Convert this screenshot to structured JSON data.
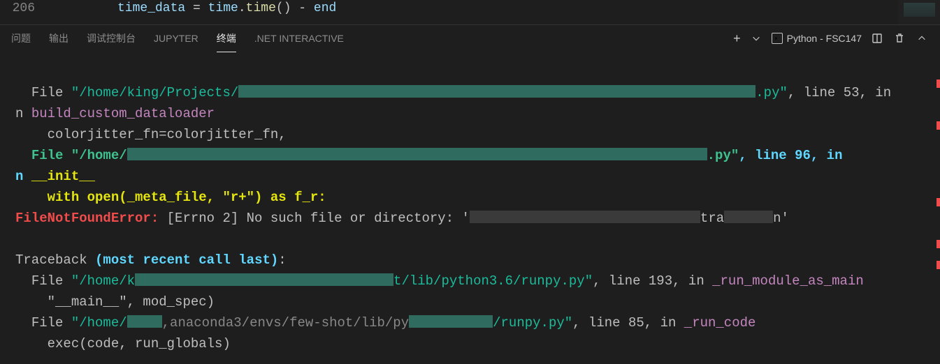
{
  "editor": {
    "line_number": "206",
    "code_frag_1": "time_data ",
    "code_frag_2": "=",
    "code_frag_3": " time",
    "code_frag_4": ".",
    "code_frag_5": "time",
    "code_frag_6": "() ",
    "code_frag_7": "-",
    "code_frag_8": " end"
  },
  "panel_tabs": {
    "problems": "问题",
    "output": "输出",
    "debug_console": "调试控制台",
    "jupyter": "JUPYTER",
    "terminal": "终端",
    "dotnet": ".NET INTERACTIVE"
  },
  "panel_actions": {
    "new_terminal_plus": "+",
    "launch_profile_label": "Python - FSC147"
  },
  "terminal": {
    "l1_file": "  File ",
    "l1_path_a": "\"/home/king/Projects/",
    "l1_path_b": ".py\"",
    "l1_tail": ", line 53, in ",
    "l1_func": "build_custom_dataloader",
    "l2": "    colorjitter_fn=colorjitter_fn,",
    "l3_file": "  File ",
    "l3_path_a": "\"/home/",
    "l3_path_b": ".py\"",
    "l3_tail": ", line 96, in ",
    "l3_func": "__init__",
    "l4": "    with open(_meta_file, \"r+\") as f_r:",
    "l5_err": "FileNotFoundError:",
    "l5_msg": " [Errno 2] No such file or directory: '",
    "l5_msg_b": "tra",
    "l5_msg_c": "n'",
    "l6": "",
    "l7_a": "Traceback ",
    "l7_b": "(most recent call last)",
    "l7_c": ":",
    "l8_file": "  File ",
    "l8_path_a": "\"/home/k",
    "l8_path_b": "t/lib/python3.6/runpy.py\"",
    "l8_tail": ", line 193, in ",
    "l8_func": "_run_module_as_main",
    "l9": "    \"__main__\", mod_spec)",
    "l10_file": "  File ",
    "l10_path_a": "\"/home/",
    "l10_path_mid": ",anaconda3/envs/few-shot/lib/py",
    "l10_path_b": "/runpy.py\"",
    "l10_tail": ", line 85, in ",
    "l10_func": "_run_code",
    "l11": "    exec(code, run_globals)"
  }
}
